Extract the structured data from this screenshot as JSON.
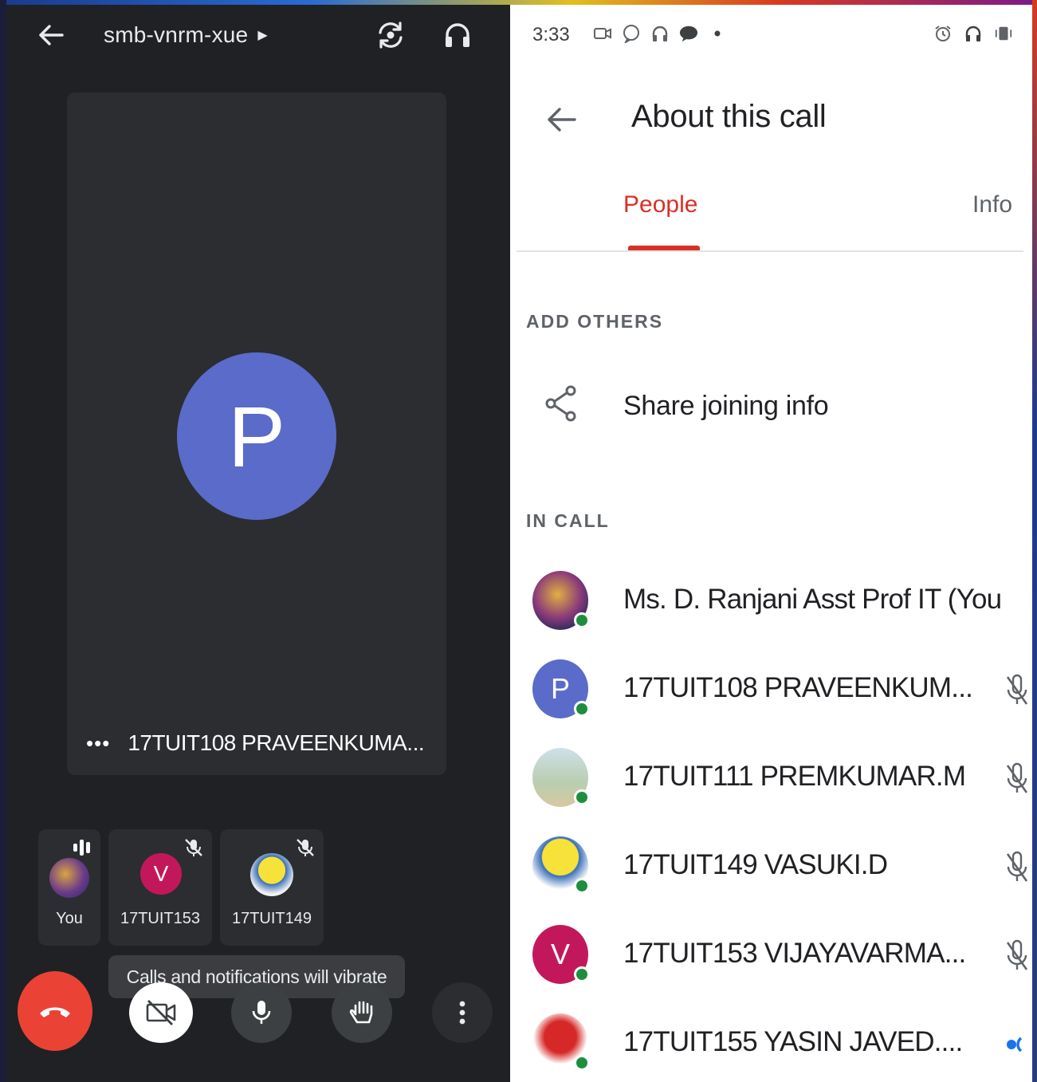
{
  "call": {
    "meeting_code": "smb-vnrm-xue",
    "main_tile": {
      "avatar_letter": "P",
      "name": "17TUIT108 PRAVEENKUMA...",
      "more_dots": "•••"
    },
    "thumbnails": [
      {
        "label": "You",
        "avatar_letter": ""
      },
      {
        "label": "17TUIT153",
        "avatar_letter": "V"
      },
      {
        "label": "17TUIT149",
        "avatar_letter": ""
      }
    ],
    "toast": "Calls and notifications will vibrate",
    "colors": {
      "end_call": "#ea4335",
      "avatar_p": "#5a6bc9",
      "avatar_v": "#c2185b"
    }
  },
  "about": {
    "status_time": "3:33",
    "title": "About this call",
    "tabs": [
      {
        "label": "People",
        "active": true
      },
      {
        "label": "Info",
        "active": false
      }
    ],
    "add_others_header": "ADD OTHERS",
    "share_label": "Share joining info",
    "in_call_header": "IN CALL",
    "people": [
      {
        "name": "Ms. D. Ranjani Asst Prof IT (You",
        "avatar_letter": "",
        "status": "online"
      },
      {
        "name": "17TUIT108 PRAVEENKUM...",
        "avatar_letter": "P",
        "status": "muted"
      },
      {
        "name": "17TUIT111 PREMKUMAR.M",
        "avatar_letter": "",
        "status": "muted"
      },
      {
        "name": "17TUIT149 VASUKI.D",
        "avatar_letter": "",
        "status": "muted"
      },
      {
        "name": "17TUIT153 VIJAYAVARMA...",
        "avatar_letter": "V",
        "status": "muted"
      },
      {
        "name": "17TUIT155 YASIN JAVED....",
        "avatar_letter": "",
        "status": "speaking"
      }
    ],
    "colors": {
      "accent": "#d93025",
      "online": "#1e8e3e"
    }
  }
}
